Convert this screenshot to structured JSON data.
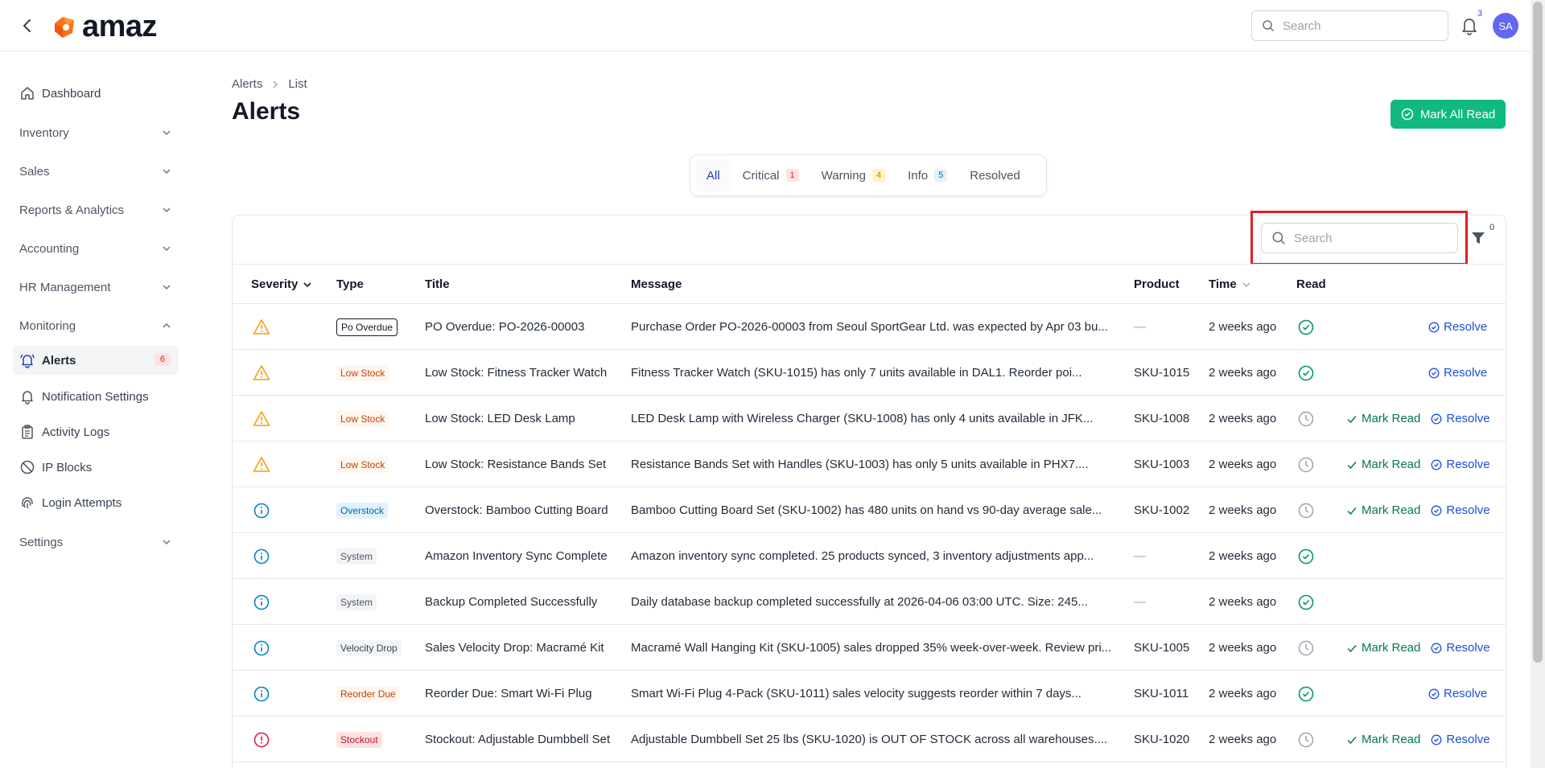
{
  "header": {
    "logo_text": "amaz",
    "search_placeholder": "Search",
    "notification_count": "3",
    "avatar_initials": "SA"
  },
  "sidebar": {
    "dashboard": "Dashboard",
    "inventory": "Inventory",
    "sales": "Sales",
    "reports": "Reports & Analytics",
    "accounting": "Accounting",
    "hr": "HR Management",
    "monitoring": "Monitoring",
    "alerts": "Alerts",
    "alerts_badge": "6",
    "notification_settings": "Notification Settings",
    "activity_logs": "Activity Logs",
    "ip_blocks": "IP Blocks",
    "login_attempts": "Login Attempts",
    "settings": "Settings"
  },
  "breadcrumb": {
    "root": "Alerts",
    "current": "List"
  },
  "page": {
    "title": "Alerts",
    "mark_all_label": "Mark All Read"
  },
  "tabs": {
    "all": "All",
    "critical": "Critical",
    "critical_count": "1",
    "warning": "Warning",
    "warning_count": "4",
    "info": "Info",
    "info_count": "5",
    "resolved": "Resolved"
  },
  "table": {
    "search_placeholder": "Search",
    "filter_count": "0",
    "columns": {
      "severity": "Severity",
      "type": "Type",
      "title": "Title",
      "message": "Message",
      "product": "Product",
      "time": "Time",
      "read": "Read"
    },
    "mark_read_label": "Mark Read",
    "resolve_label": "Resolve",
    "rows": [
      {
        "type": "Po Overdue",
        "title": "PO Overdue: PO-2026-00003",
        "message": "Purchase Order PO-2026-00003 from Seoul SportGear Ltd. was expected by Apr 03 bu...",
        "product": "—",
        "time": "2 weeks ago"
      },
      {
        "type": "Low Stock",
        "title": "Low Stock: Fitness Tracker Watch",
        "message": "Fitness Tracker Watch (SKU-1015) has only 7 units available in DAL1. Reorder poi...",
        "product": "SKU-1015",
        "time": "2 weeks ago"
      },
      {
        "type": "Low Stock",
        "title": "Low Stock: LED Desk Lamp",
        "message": "LED Desk Lamp with Wireless Charger (SKU-1008) has only 4 units available in JFK...",
        "product": "SKU-1008",
        "time": "2 weeks ago"
      },
      {
        "type": "Low Stock",
        "title": "Low Stock: Resistance Bands Set",
        "message": "Resistance Bands Set with Handles (SKU-1003) has only 5 units available in PHX7....",
        "product": "SKU-1003",
        "time": "2 weeks ago"
      },
      {
        "type": "Overstock",
        "title": "Overstock: Bamboo Cutting Board",
        "message": "Bamboo Cutting Board Set (SKU-1002) has 480 units on hand vs 90-day average sale...",
        "product": "SKU-1002",
        "time": "2 weeks ago"
      },
      {
        "type": "System",
        "title": "Amazon Inventory Sync Complete",
        "message": "Amazon inventory sync completed. 25 products synced, 3 inventory adjustments app...",
        "product": "—",
        "time": "2 weeks ago"
      },
      {
        "type": "System",
        "title": "Backup Completed Successfully",
        "message": "Daily database backup completed successfully at 2026-04-06 03:00 UTC. Size: 245...",
        "product": "—",
        "time": "2 weeks ago"
      },
      {
        "type": "Velocity Drop",
        "title": "Sales Velocity Drop: Macramé Kit",
        "message": "Macramé Wall Hanging Kit (SKU-1005) sales dropped 35% week-over-week. Review pri...",
        "product": "SKU-1005",
        "time": "2 weeks ago"
      },
      {
        "type": "Reorder Due",
        "title": "Reorder Due: Smart Wi-Fi Plug",
        "message": "Smart Wi-Fi Plug 4-Pack (SKU-1011) sales velocity suggests reorder within 7 days...",
        "product": "SKU-1011",
        "time": "2 weeks ago"
      },
      {
        "type": "Stockout",
        "title": "Stockout: Adjustable Dumbbell Set",
        "message": "Adjustable Dumbbell Set 25 lbs (SKU-1020) is OUT OF STOCK across all warehouses....",
        "product": "SKU-1020",
        "time": "2 weeks ago"
      }
    ]
  },
  "colors": {
    "accent_green": "#10b981",
    "warning_orange": "#f59e0b",
    "info_blue": "#0284c7",
    "critical_red": "#e11d48",
    "highlight_red": "#e11d28"
  }
}
